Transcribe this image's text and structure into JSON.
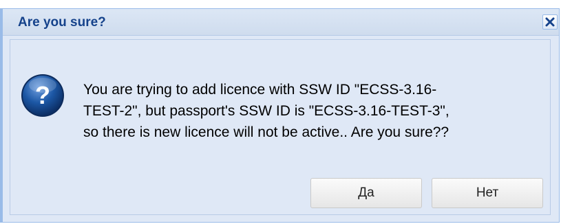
{
  "dialog": {
    "title": "Are you sure?",
    "message": "You are trying to add licence with SSW ID \"ECSS-3.16-\nTEST-2\", but passport's SSW ID is \"ECSS-3.16-TEST-3\",\nso there is new licence will not be active.. Are you sure??",
    "buttons": {
      "yes_label": "Да",
      "no_label": "Нет"
    },
    "icons": {
      "close": "close-icon",
      "question": "question-icon"
    },
    "colors": {
      "title": "#15428b",
      "frame": "#99bbe8",
      "background": "#dfe8f6",
      "icon": "#1c57a5"
    }
  }
}
